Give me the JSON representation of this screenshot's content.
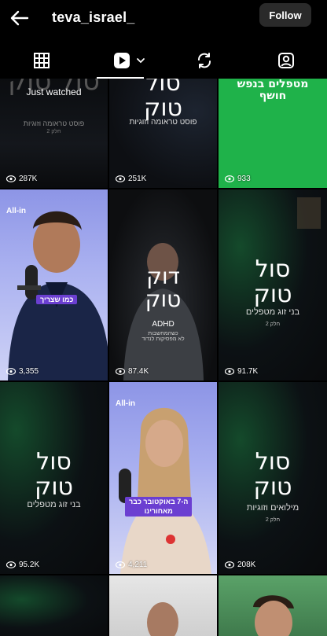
{
  "header": {
    "username": "teva_israel_",
    "follow_label": "Follow"
  },
  "tabs": [
    {
      "name": "grid",
      "icon": "grid-icon"
    },
    {
      "name": "reels",
      "icon": "reels-play-icon"
    },
    {
      "name": "reposts",
      "icon": "repost-icon"
    },
    {
      "name": "tagged",
      "icon": "tagged-person-icon"
    }
  ],
  "cells": [
    {
      "views": "287K",
      "title": "סול\nטוק",
      "badge": "Just watched",
      "subtitle": "פוסט טראומה וזוגיות",
      "tiny": "חלק 2"
    },
    {
      "views": "251K",
      "title": "סול\nטוק",
      "subtitle": "פוסט טראומה וזוגיות"
    },
    {
      "views": "933",
      "title": "מטפלים בנפש\nחושף"
    },
    {
      "views": "3,355",
      "brand": "All-in",
      "caption": "כמו שצריך"
    },
    {
      "views": "87.4K",
      "title": "דוק\nטוק",
      "subtitle": "ADHD",
      "tiny": "כשהמחשבות\nלא מפסיקות לנדוד"
    },
    {
      "views": "91.7K",
      "title": "סול\nטוק",
      "subtitle": "בני זוג מטפלים",
      "tiny": "חלק 2"
    },
    {
      "views": "95.2K",
      "title": "סול\nטוק",
      "subtitle": "בני זוג מטפלים"
    },
    {
      "views": "4,211",
      "brand": "All-in",
      "caption": "ה-7 באוקטובר כבר\nמאחורינו"
    },
    {
      "views": "208K",
      "title": "סול\nטוק",
      "subtitle": "מילואים וזוגיות",
      "tiny": "חלק 2"
    },
    {
      "views": ""
    },
    {
      "views": ""
    },
    {
      "views": ""
    }
  ],
  "colors": {
    "background": "#000000",
    "green_tile": "#1fb24a",
    "caption_purple": "#6b3fd1"
  }
}
